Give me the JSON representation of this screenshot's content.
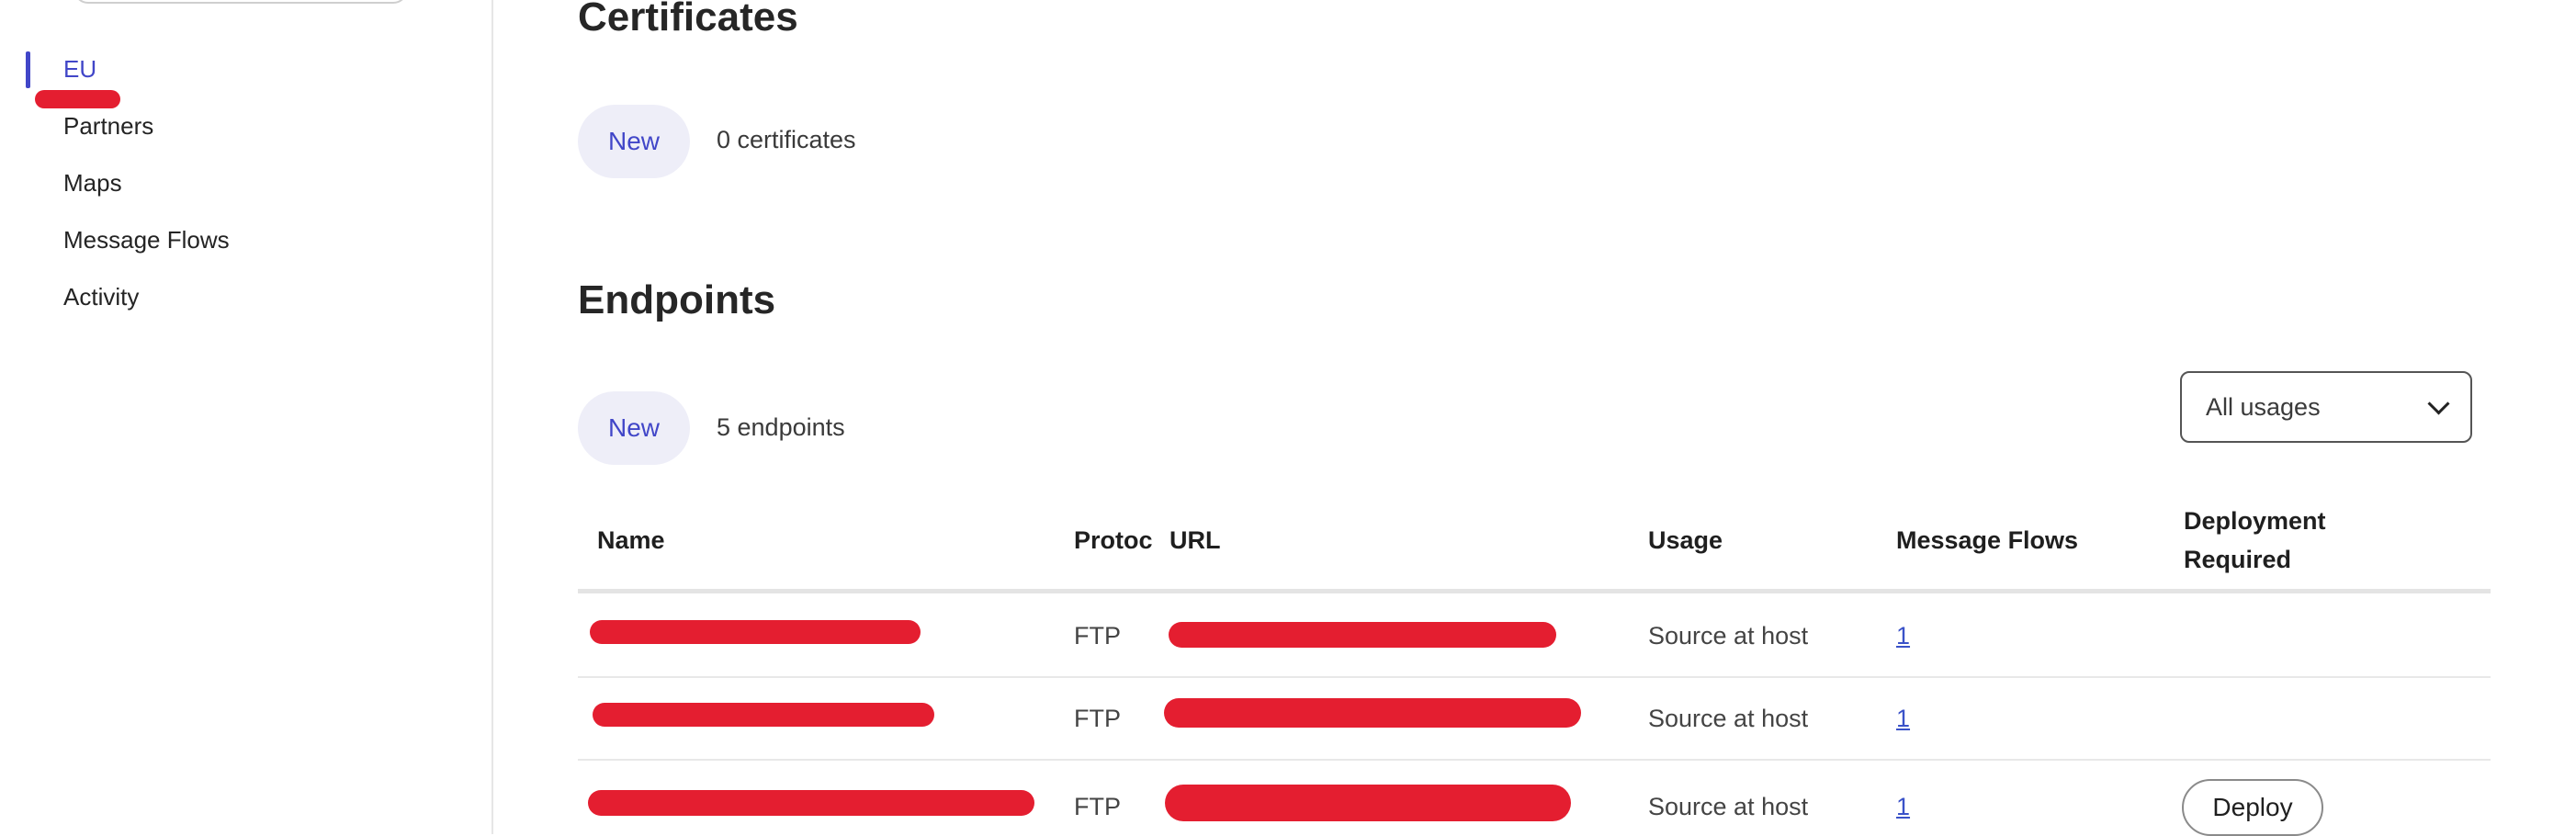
{
  "sidebar": {
    "items": [
      {
        "label": "EU"
      },
      {
        "label": "Partners"
      },
      {
        "label": "Maps"
      },
      {
        "label": "Message Flows"
      },
      {
        "label": "Activity"
      }
    ]
  },
  "certificates": {
    "title": "Certificates",
    "new_label": "New",
    "count": "0 certificates"
  },
  "endpoints": {
    "title": "Endpoints",
    "new_label": "New",
    "count": "5 endpoints",
    "filter": "All usages",
    "columns": {
      "name": "Name",
      "protocol": "Protoc",
      "url": "URL",
      "usage": "Usage",
      "message_flows": "Message Flows",
      "deployment_line1": "Deployment",
      "deployment_line2": "Required"
    },
    "rows": [
      {
        "protocol": "FTP",
        "usage": "Source at host",
        "flows": "1",
        "deploy": ""
      },
      {
        "protocol": "FTP",
        "usage": "Source at host",
        "flows": "1",
        "deploy": ""
      },
      {
        "protocol": "FTP",
        "usage": "Source at host",
        "flows": "1",
        "deploy": "Deploy"
      }
    ]
  },
  "colors": {
    "accent": "#4146c8",
    "redaction": "#e41e30",
    "link": "#3a52c8"
  }
}
